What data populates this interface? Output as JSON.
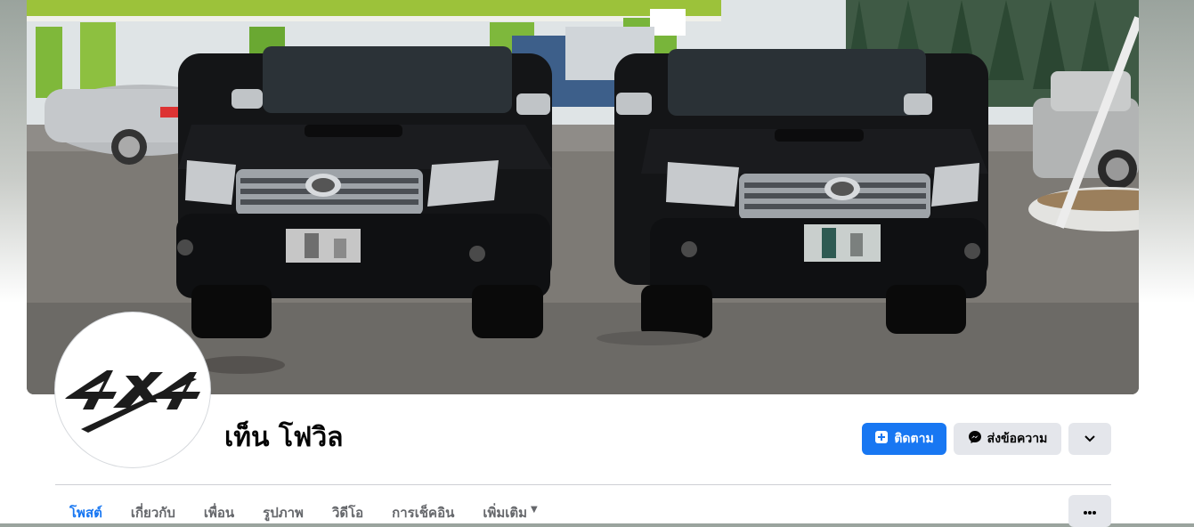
{
  "profile": {
    "name": "เท็น โฟวิล",
    "avatar_logo": "4X4"
  },
  "actions": {
    "follow_label": "ติดตาม",
    "message_label": "ส่งข้อความ",
    "follow_icon": "plus-square-icon",
    "message_icon": "messenger-icon",
    "more_icon": "chevron-down-icon"
  },
  "tabs": [
    {
      "label": "โพสต์",
      "active": true
    },
    {
      "label": "เกี่ยวกับ",
      "active": false
    },
    {
      "label": "เพื่อน",
      "active": false
    },
    {
      "label": "รูปภาพ",
      "active": false
    },
    {
      "label": "วิดีโอ",
      "active": false
    },
    {
      "label": "การเช็คอิน",
      "active": false
    },
    {
      "label": "เพิ่มเติม",
      "active": false
    }
  ],
  "tab_overflow_icon": "ellipsis-icon",
  "colors": {
    "accent": "#1877f2",
    "button_secondary": "#e4e6eb",
    "text_primary": "#050505",
    "text_secondary": "#65676b"
  },
  "cover_photo": {
    "description": ""
  }
}
